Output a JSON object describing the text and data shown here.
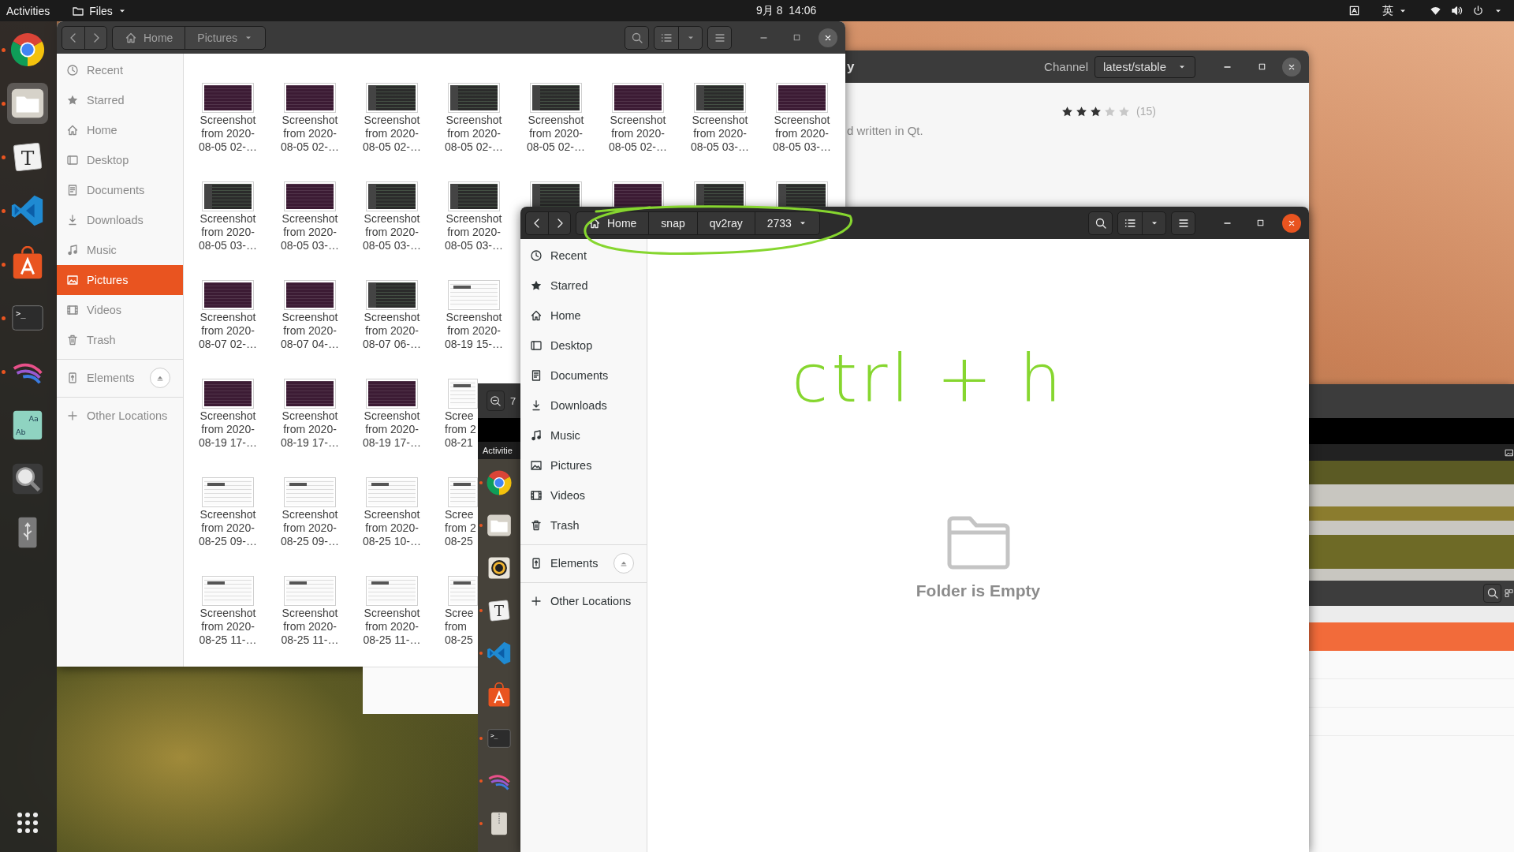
{
  "top_bar": {
    "activities": "Activities",
    "app_menu": "Files",
    "clock": "9月 8  14:06",
    "input_method": "英"
  },
  "dock": {
    "items": [
      {
        "kind": "chrome",
        "running": true,
        "selected": false
      },
      {
        "kind": "files",
        "running": true,
        "selected": true
      },
      {
        "kind": "text-editor",
        "running": true,
        "selected": false,
        "glyphs": [
          "T"
        ]
      },
      {
        "kind": "vscode",
        "running": true,
        "selected": false
      },
      {
        "kind": "software",
        "running": true,
        "selected": false
      },
      {
        "kind": "terminal",
        "running": true,
        "selected": false,
        "glyphs": [
          ">_"
        ]
      },
      {
        "kind": "feather",
        "running": true,
        "selected": false
      },
      {
        "kind": "fonts",
        "running": false,
        "selected": false,
        "glyphs": [
          "Aa",
          "Ab"
        ]
      },
      {
        "kind": "magnifier",
        "running": false,
        "selected": false
      },
      {
        "kind": "usb",
        "running": false,
        "selected": false
      }
    ]
  },
  "software_window": {
    "title": "y",
    "channel_label": "Channel",
    "channel": "latest/stable",
    "stars": 3,
    "review_count": "(15)",
    "description": "d written in Qt."
  },
  "pictures_window": {
    "focused": false,
    "path": [
      {
        "label": "Home",
        "kind": "home"
      },
      {
        "label": "Pictures",
        "kind": "folder"
      }
    ],
    "places": [
      {
        "label": "Recent",
        "kind": "recent",
        "selected": false
      },
      {
        "label": "Starred",
        "kind": "starred",
        "selected": false
      },
      {
        "label": "Home",
        "kind": "home",
        "selected": false
      },
      {
        "label": "Desktop",
        "kind": "desktop",
        "selected": false
      },
      {
        "label": "Documents",
        "kind": "documents",
        "selected": false
      },
      {
        "label": "Downloads",
        "kind": "downloads",
        "selected": false
      },
      {
        "label": "Music",
        "kind": "music",
        "selected": false
      },
      {
        "label": "Pictures",
        "kind": "pictures",
        "selected": true
      },
      {
        "label": "Videos",
        "kind": "videos",
        "selected": false
      },
      {
        "label": "Trash",
        "kind": "trash",
        "selected": false
      }
    ],
    "devices": [
      {
        "label": "Elements",
        "kind": "drive",
        "selected": false
      },
      {
        "label": "Other Locations",
        "kind": "other",
        "selected": false
      }
    ],
    "files": [
      [
        {
          "kind": "purple",
          "label": "Screenshot\nfrom 2020-\n08-05 02-…",
          "cut": false
        },
        {
          "kind": "purple",
          "label": "Screenshot\nfrom 2020-\n08-05 02-…",
          "cut": false
        },
        {
          "kind": "dark",
          "label": "Screenshot\nfrom 2020-\n08-05 02-…",
          "cut": false
        },
        {
          "kind": "dark",
          "label": "Screenshot\nfrom 2020-\n08-05 02-…",
          "cut": false
        },
        {
          "kind": "dark",
          "label": "Screenshot\nfrom 2020-\n08-05 02-…",
          "cut": false
        },
        {
          "kind": "purple",
          "label": "Screenshot\nfrom 2020-\n08-05 02-…",
          "cut": false
        },
        {
          "kind": "dark",
          "label": "Screenshot\nfrom 2020-\n08-05 03-…",
          "cut": false
        },
        {
          "kind": "purple",
          "label": "Screenshot\nfrom 2020-\n08-05 03-…",
          "cut": false
        }
      ],
      [
        {
          "kind": "dark",
          "label": "Screenshot\nfrom 2020-\n08-05 03-…",
          "cut": false
        },
        {
          "kind": "purple",
          "label": "Screenshot\nfrom 2020-\n08-05 03-…",
          "cut": false
        },
        {
          "kind": "dark",
          "label": "Screenshot\nfrom 2020-\n08-05 03-…",
          "cut": false
        },
        {
          "kind": "dark",
          "label": "Screenshot\nfrom 2020-\n08-05 03-…",
          "cut": false
        },
        {
          "kind": "dark"
        },
        {
          "kind": "purple"
        },
        {
          "kind": "dark"
        },
        {
          "kind": "dark"
        }
      ],
      [
        {
          "kind": "purple",
          "label": "Screenshot\nfrom 2020-\n08-07 02-…",
          "cut": false
        },
        {
          "kind": "purple",
          "label": "Screenshot\nfrom 2020-\n08-07 04-…",
          "cut": false
        },
        {
          "kind": "dark",
          "label": "Screenshot\nfrom 2020-\n08-07 06-…",
          "cut": false
        },
        {
          "kind": "light",
          "label": "Screenshot\nfrom 2020-\n08-19 15-…",
          "cut": false
        }
      ],
      [
        {
          "kind": "purple",
          "label": "Screenshot\nfrom 2020-\n08-19 17-…",
          "cut": false
        },
        {
          "kind": "purple",
          "label": "Screenshot\nfrom 2020-\n08-19 17-…",
          "cut": false
        },
        {
          "kind": "purple",
          "label": "Screenshot\nfrom 2020-\n08-19 17-…",
          "cut": false
        },
        {
          "kind": "light",
          "label": "Scree\nfrom 2\n08-21",
          "cut": true
        }
      ],
      [
        {
          "kind": "light",
          "label": "Screenshot\nfrom 2020-\n08-25 09-…",
          "cut": false
        },
        {
          "kind": "light",
          "label": "Screenshot\nfrom 2020-\n08-25 09-…",
          "cut": false
        },
        {
          "kind": "light",
          "label": "Screenshot\nfrom 2020-\n08-25 10-…",
          "cut": false
        },
        {
          "kind": "light",
          "label": "Scree\nfrom 2\n08-25",
          "cut": true
        }
      ],
      [
        {
          "kind": "light",
          "label": "Screenshot\nfrom 2020-\n08-25 11-…",
          "cut": false
        },
        {
          "kind": "light",
          "label": "Screenshot\nfrom 2020-\n08-25 11-…",
          "cut": false
        },
        {
          "kind": "light",
          "label": "Screenshot\nfrom 2020-\n08-25 11-…",
          "cut": false
        },
        {
          "kind": "light",
          "label": "Scree\nfrom\n08-25",
          "cut": true
        }
      ]
    ]
  },
  "viewer_window": {
    "zoom": "7",
    "activities": "Activitie",
    "dock": [
      {
        "kind": "chrome",
        "running": true
      },
      {
        "kind": "files",
        "running": true
      },
      {
        "kind": "rhythmbox",
        "running": false
      },
      {
        "kind": "text-editor",
        "running": true,
        "glyphs": [
          "T"
        ]
      },
      {
        "kind": "vscode",
        "running": true
      },
      {
        "kind": "software",
        "running": false
      },
      {
        "kind": "terminal",
        "running": true,
        "glyphs": [
          ">_"
        ]
      },
      {
        "kind": "feather",
        "running": true
      },
      {
        "kind": "archive",
        "running": true
      }
    ]
  },
  "folder_window": {
    "focused": true,
    "path": [
      {
        "label": "Home",
        "kind": "home"
      },
      {
        "label": "snap",
        "kind": "folder"
      },
      {
        "label": "qv2ray",
        "kind": "folder"
      },
      {
        "label": "2733",
        "kind": "folder"
      }
    ],
    "places": [
      {
        "label": "Recent",
        "kind": "recent",
        "selected": false
      },
      {
        "label": "Starred",
        "kind": "starred",
        "selected": false
      },
      {
        "label": "Home",
        "kind": "home",
        "selected": false
      },
      {
        "label": "Desktop",
        "kind": "desktop",
        "selected": false
      },
      {
        "label": "Documents",
        "kind": "documents",
        "selected": false
      },
      {
        "label": "Downloads",
        "kind": "downloads",
        "selected": false
      },
      {
        "label": "Music",
        "kind": "music",
        "selected": false
      },
      {
        "label": "Pictures",
        "kind": "pictures",
        "selected": false
      },
      {
        "label": "Videos",
        "kind": "videos",
        "selected": false
      },
      {
        "label": "Trash",
        "kind": "trash",
        "selected": false
      }
    ],
    "devices": [
      {
        "label": "Elements",
        "kind": "drive",
        "selected": false
      },
      {
        "label": "Other Locations",
        "kind": "other",
        "selected": false
      }
    ],
    "empty_message": "Folder is Empty"
  },
  "annotation": {
    "text": "ctrl + h"
  }
}
